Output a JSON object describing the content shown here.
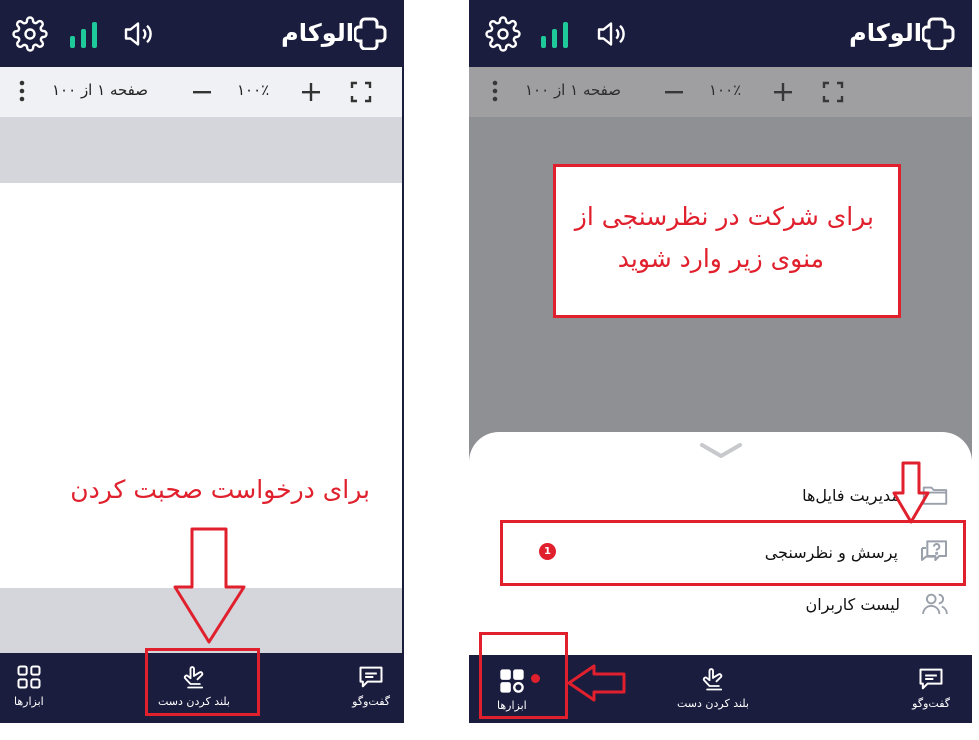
{
  "left_phone": {
    "app_name": "الوکام",
    "toolbar": {
      "page_info": "صفحه ۱ از ۱۰۰",
      "zoom": "۱۰۰٪"
    },
    "annotation": "برای درخواست صحبت کردن",
    "bottom_nav": {
      "chat": "گفت‌وگو",
      "raise_hand": "بلند کردن دست",
      "tools": "ابزارها"
    }
  },
  "right_phone": {
    "app_name": "الوکام",
    "toolbar": {
      "page_info": "صفحه ۱ از ۱۰۰",
      "zoom": "۱۰۰٪"
    },
    "annotation_line1": "برای شرکت در نظرسنجی از",
    "annotation_line2": "منوی زیر وارد شوید",
    "menu": {
      "file_management": "مدیریت فایل‌ها",
      "qa_poll": "پرسش و نظرسنجی",
      "qa_poll_badge": "1",
      "user_list": "لیست کاربران"
    },
    "bottom_nav": {
      "chat": "گفت‌وگو",
      "raise_hand": "بلند کردن دست",
      "tools": "ابزارها"
    }
  },
  "colors": {
    "navy": "#1b1d3e",
    "signal_green": "#1ec99a",
    "annotation_red": "#e0202d",
    "toolbar_bg": "#f0f1f4"
  }
}
